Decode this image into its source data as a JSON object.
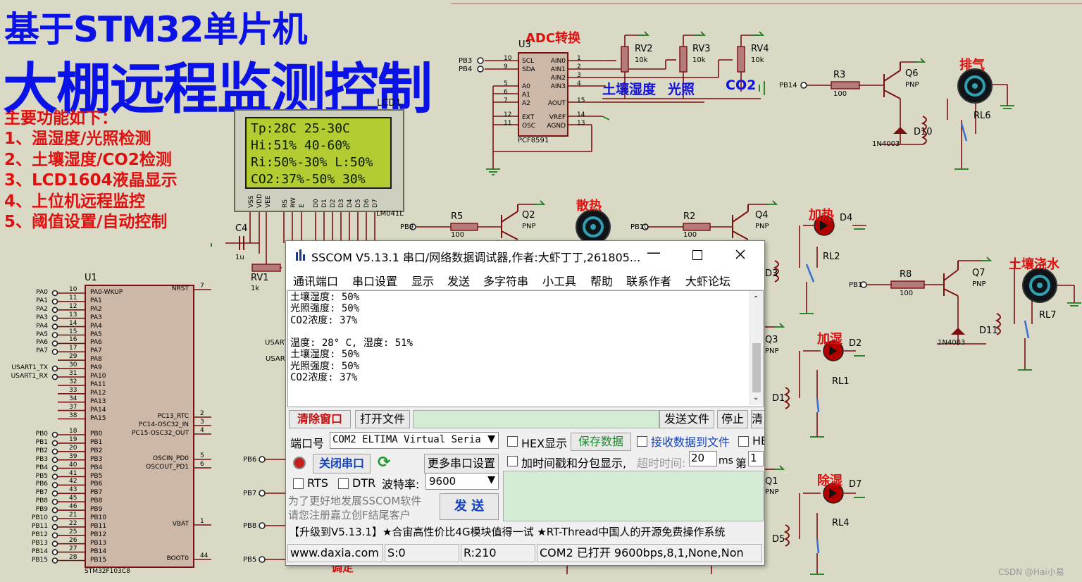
{
  "titles": {
    "line1": "基于STM32单片机",
    "line2": "大棚远程监测控制"
  },
  "features": {
    "heading": "主要功能如下：",
    "items": [
      "1、温湿度/光照检测",
      "2、土壤湿度/CO2检测",
      "3、LCD1604液晶显示",
      "4、上位机远程监控",
      "5、阈值设置/自动控制"
    ]
  },
  "lcd": {
    "ref": "LCD1",
    "part": "LM041L",
    "lines": [
      "Tp:28C  25-30C",
      "Hi:51%  40-60%",
      "Ri:50%-30%  L:50%",
      "CO2:37%-50%   30%"
    ],
    "pins": [
      "VSS",
      "VDD",
      "VEE",
      "RS",
      "RW",
      "E",
      "D0",
      "D1",
      "D2",
      "D3",
      "D4",
      "D5",
      "D6",
      "D7"
    ]
  },
  "adc": {
    "label": "ADC转换",
    "ref": "U3",
    "part": "PCF8591",
    "pins_left": [
      "SCL",
      "SDA",
      "A0",
      "A1",
      "A2",
      "EXT",
      "OSC"
    ],
    "pins_right": [
      "AIN0",
      "AIN1",
      "AIN2",
      "AIN3",
      "AOUT",
      "VREF",
      "AGND"
    ],
    "nums_left": [
      "10",
      "9",
      "5",
      "6",
      "7",
      "12",
      "11"
    ],
    "nums_right": [
      "1",
      "2",
      "3",
      "4",
      "15",
      "14",
      "13"
    ],
    "ports": [
      "PB3",
      "PB4"
    ]
  },
  "pots": [
    {
      "ref": "RV2",
      "val": "10k"
    },
    {
      "ref": "RV3",
      "val": "10k"
    },
    {
      "ref": "RV4",
      "val": "10k"
    }
  ],
  "sensor_labels": {
    "soil": "土壤湿度",
    "light": "光照",
    "co2": "CO2"
  },
  "mcu": {
    "ref": "U1",
    "part": "STM32F103C8",
    "left_ports": [
      "PA0",
      "PA1",
      "PA2",
      "PA3",
      "PA4",
      "PA5",
      "PA6",
      "PA7",
      "",
      "USART1_TX",
      "USART1_RX",
      "",
      "",
      "",
      "",
      "",
      "PB0",
      "PB1",
      "PB2",
      "PB3",
      "PB4",
      "PB5",
      "PB6",
      "PB7",
      "PB8",
      "PB9",
      "PB10",
      "PB11",
      "PB12",
      "PB13",
      "PB14",
      "PB15"
    ],
    "left_pins": [
      "PA0-WKUP",
      "PA1",
      "PA2",
      "PA3",
      "PA4",
      "PA5",
      "PA6",
      "PA7",
      "PA8",
      "PA9",
      "PA10",
      "PA11",
      "PA12",
      "PA13",
      "PA14",
      "PA15",
      "PB0",
      "PB1",
      "PB2",
      "PB3",
      "PB4",
      "PB5",
      "PB6",
      "PB7",
      "PB8",
      "PB9",
      "PB10",
      "PB11",
      "PB12",
      "PB13",
      "PB14",
      "PB15"
    ],
    "left_nums": [
      "10",
      "11",
      "12",
      "13",
      "14",
      "15",
      "16",
      "17",
      "29",
      "30",
      "31",
      "32",
      "33",
      "34",
      "37",
      "38",
      "18",
      "19",
      "20",
      "39",
      "40",
      "41",
      "42",
      "43",
      "45",
      "46",
      "21",
      "22",
      "25",
      "26",
      "27",
      "28"
    ],
    "right_pins": [
      {
        "n": "NRST",
        "p": "7"
      },
      {
        "n": "PC13_RTC",
        "p": "2"
      },
      {
        "n": "PC14-OSC32_IN",
        "p": "3"
      },
      {
        "n": "PC15-OSC32_OUT",
        "p": "4"
      },
      {
        "n": "OSCIN_PD0",
        "p": "5"
      },
      {
        "n": "OSCOUT_PD1",
        "p": "6"
      },
      {
        "n": "VBAT",
        "p": "1"
      },
      {
        "n": "BOOT0",
        "p": "44"
      }
    ]
  },
  "misc": {
    "c4": "C4",
    "c4v": "1u",
    "rv1": "RV1",
    "rv1v": "1k",
    "usart1": "USART",
    "usart2": "USAR"
  },
  "drivers": [
    {
      "title": "排气",
      "port": "PB14",
      "r": "R3",
      "rv": "100",
      "q": "Q6",
      "pnp": "PNP",
      "d": "D10",
      "dpart": "1N4003",
      "relay": "RL6"
    },
    {
      "title": "散热",
      "port": "PB9",
      "r": "R5",
      "rv": "100",
      "q": "Q2",
      "pnp": "PNP"
    },
    {
      "title": "加热",
      "port": "PB10",
      "r": "R2",
      "rv": "100",
      "q": "Q4",
      "pnp": "PNP",
      "d": "D4",
      "relay": "RL2",
      "d2": "D3"
    },
    {
      "title": "土壤浇水",
      "port": "PB1",
      "r": "R8",
      "rv": "100",
      "q": "Q7",
      "pnp": "PNP",
      "d": "D11",
      "dpart": "1N4003",
      "relay": "RL7"
    },
    {
      "title": "加湿",
      "q": "Q3",
      "pnp": "PNP",
      "d": "D2",
      "relay": "RL1",
      "d2": "D1"
    },
    {
      "title": "除湿",
      "q": "Q1",
      "pnp": "PNP",
      "d": "D7",
      "relay": "RL4",
      "d2": "D5"
    }
  ],
  "left_ports_extra": [
    "PB6",
    "PB7",
    "PB8",
    "PB5"
  ],
  "overlap_text": "调定",
  "sscom": {
    "title": "SSCOM V5.13.1 串口/网络数据调试器,作者:大虾丁丁,261805...",
    "menu": [
      "通讯端口",
      "串口设置",
      "显示",
      "发送",
      "多字符串",
      "小工具",
      "帮助",
      "联系作者",
      "大虾论坛"
    ],
    "received": [
      "土壤湿度: 50%",
      "光照强度: 50%",
      "CO2浓度: 37%",
      "",
      "温度: 28° C, 湿度: 51%",
      "土壤湿度: 50%",
      "光照强度: 50%",
      "CO2浓度: 37%"
    ],
    "clear_btn": "清除窗口",
    "open_file_btn": "打开文件",
    "send_file_btn": "发送文件",
    "stop_btn": "停止",
    "cut_btn": "清",
    "port_label": "端口号",
    "port_value": "COM2 ELTIMA Virtual Serial",
    "hex_display": "HEX显示",
    "save_data": "保存数据",
    "recv_to_file": "接收数据到文件",
    "hex_send": "HE",
    "close_port": "关闭串口",
    "more_settings": "更多串口设置",
    "timestamp": "加时间戳和分包显示,",
    "timeout_label": "超时时间:",
    "timeout_value": "20",
    "ms": "ms",
    "nth": "第",
    "nth_value": "1",
    "rts": "RTS",
    "dtr": "DTR",
    "baud_label": "波特率:",
    "baud_value": "9600",
    "promo": [
      "为了更好地发展SSCOM软件",
      "请您注册嘉立创F结尾客户"
    ],
    "send_btn": "发 送",
    "ticker": "【升级到V5.13.1】★合宙高性价比4G模块值得一试 ★RT-Thread中国人的开源免费操作系统 ",
    "status": [
      "www.daxia.com",
      "S:0",
      "R:210",
      "COM2 已打开  9600bps,8,1,None,Non"
    ]
  },
  "watermark": "CSDN @Hai小易"
}
